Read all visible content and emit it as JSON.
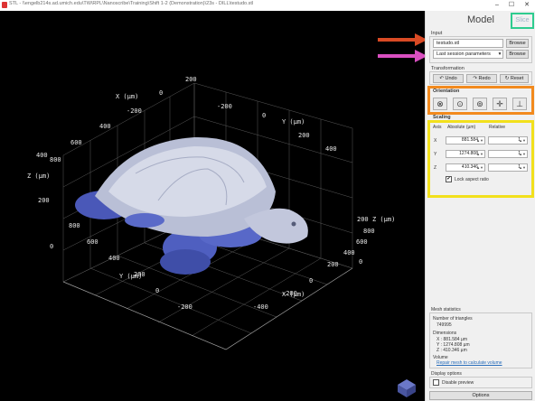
{
  "window": {
    "title": "STL - \\\\engelb214s.ad.umich.edu\\TW\\RPL\\Nanoscribe\\Training\\Shift 1-2 (Demonstration)\\23s - DILL\\testudo.stl",
    "minimize": "–",
    "maximize": "☐",
    "close": "✕"
  },
  "panel": {
    "title": "Model",
    "slice_tab": "Slice",
    "input": {
      "label": "Input",
      "file_value": "testudo.stl",
      "browse1": "Browse",
      "params_value": "Last session parameters",
      "browse2": "Browse"
    },
    "transformation": {
      "label": "Transformation",
      "undo": "Undo",
      "redo": "Redo",
      "reset": "Reset"
    },
    "orientation": {
      "label": "Orientation"
    },
    "scaling": {
      "label": "Scaling",
      "col_axis": "Axis",
      "col_absolute": "Absolute (µm)",
      "col_relative": "Relative",
      "rows": [
        {
          "axis": "X",
          "absolute": "881.584",
          "relative": "1"
        },
        {
          "axis": "Y",
          "absolute": "1274.808",
          "relative": "1"
        },
        {
          "axis": "Z",
          "absolute": "410.346",
          "relative": "1"
        }
      ],
      "lock_label": "Lock aspect ratio",
      "lock_checked": "✔"
    },
    "stats": {
      "label": "Mesh statistics",
      "triangles_label": "Number of triangles",
      "triangles_value": "749995",
      "dimensions_label": "Dimensions",
      "dim_x": "X : 881.584 µm",
      "dim_y": "Y : 1274.808 µm",
      "dim_z": "Z : 410.346 µm",
      "volume_label": "Volume",
      "volume_link": "Repair mesh to calculate volume"
    },
    "display": {
      "label": "Display options",
      "disable_preview": "Disable preview"
    },
    "options_button": "Options"
  },
  "viewport": {
    "x_axis_title": "X  (µm)",
    "y_axis_title": "Y  (µm)",
    "z_axis_title": "Z  (µm)",
    "x_ticks_top": [
      "-200",
      "0",
      "200",
      "400",
      "600",
      "800"
    ],
    "y_ticks_top": [
      "-200",
      "0",
      "200",
      "400"
    ],
    "z_ticks": [
      "400",
      "200",
      "0"
    ],
    "x_ticks_bottom": [
      "-400",
      "-200",
      "0",
      "200",
      "400",
      "600",
      "800"
    ],
    "y_ticks_bottom": [
      "800",
      "600",
      "400",
      "200",
      "0",
      "-200"
    ],
    "z_ticks_right": [
      "200",
      "0"
    ]
  },
  "colors": {
    "arrow_red": "#d94a24",
    "arrow_magenta": "#d94fc0",
    "highlight_orange": "#f28a1e",
    "highlight_yellow": "#f2e01c",
    "highlight_green": "#2ecc8f",
    "model": "#7f8fd6"
  }
}
